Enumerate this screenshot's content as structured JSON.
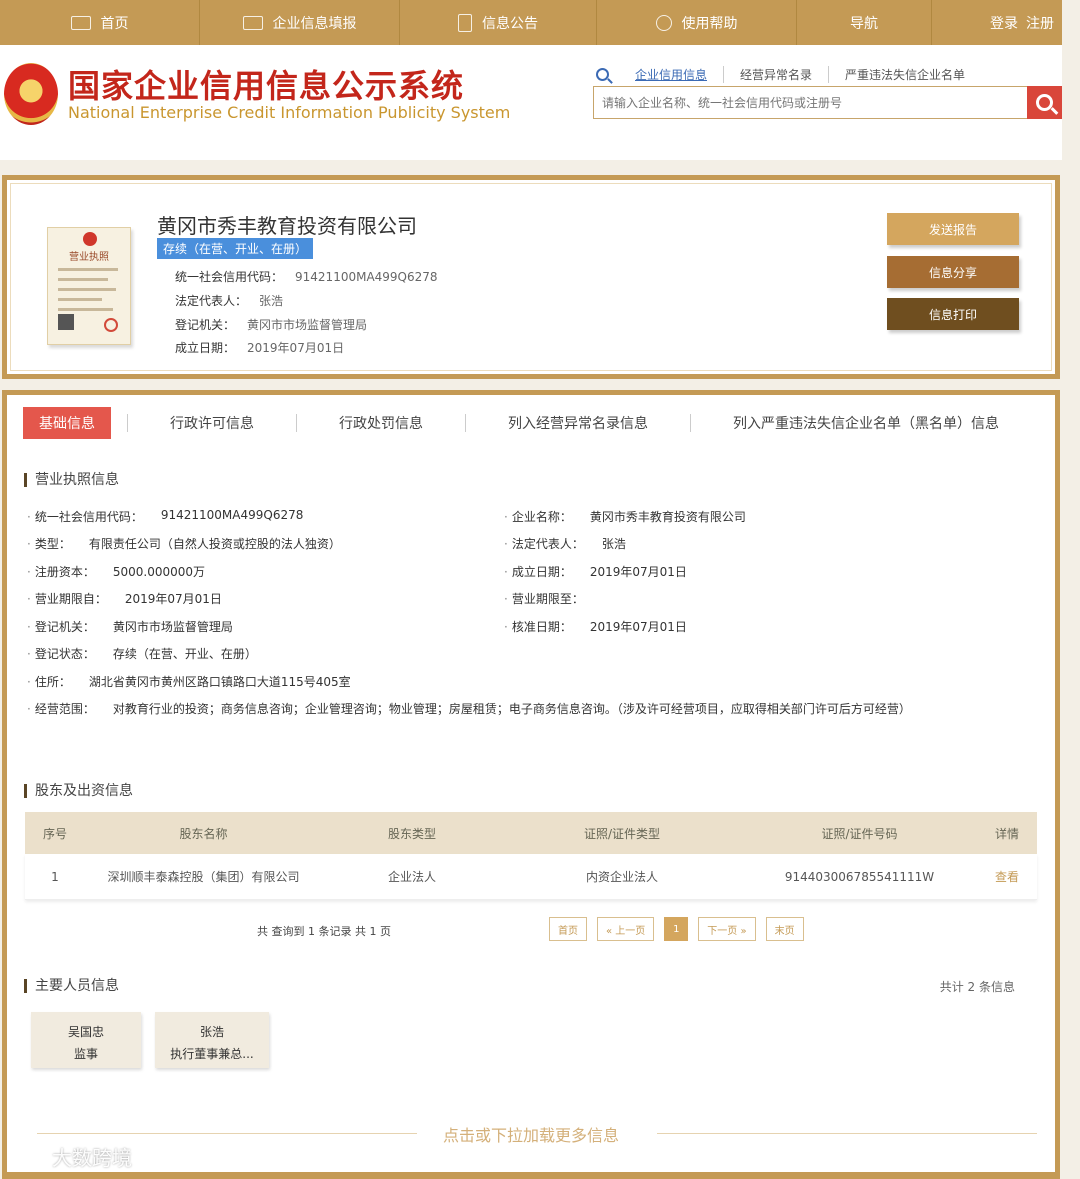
{
  "nav": {
    "home": "首页",
    "fill": "企业信息填报",
    "notice": "信息公告",
    "help": "使用帮助",
    "guide": "导航",
    "login": "登录",
    "register": "注册"
  },
  "header": {
    "title": "国家企业信用信息公示系统",
    "subtitle": "National Enterprise Credit Information Publicity System",
    "search_tabs": [
      "企业信用信息",
      "经营异常名录",
      "严重违法失信企业名单"
    ],
    "search_placeholder": "请输入企业名称、统一社会信用代码或注册号"
  },
  "company": {
    "name": "黄冈市秀丰教育投资有限公司",
    "status": "存续（在营、开业、在册）",
    "license_label": "营业执照",
    "credit_code_label": "统一社会信用代码：",
    "credit_code": "91421100MA499Q6278",
    "legal_rep_label": "法定代表人：",
    "legal_rep": "张浩",
    "authority_label": "登记机关：",
    "authority": "黄冈市市场监督管理局",
    "founded_label": "成立日期：",
    "founded": "2019年07月01日",
    "buttons": {
      "report": "发送报告",
      "share": "信息分享",
      "print": "信息打印"
    }
  },
  "tabs": [
    "基础信息",
    "行政许可信息",
    "行政处罚信息",
    "列入经营异常名录信息",
    "列入严重违法失信企业名单（黑名单）信息"
  ],
  "license_section": {
    "title": "营业执照信息",
    "credit_code_label": "统一社会信用代码：",
    "credit_code": "91421100MA499Q6278",
    "name_label": "企业名称：",
    "name": "黄冈市秀丰教育投资有限公司",
    "type_label": "类型：",
    "type": "有限责任公司（自然人投资或控股的法人独资）",
    "legal_rep_label": "法定代表人：",
    "legal_rep": "张浩",
    "capital_label": "注册资本：",
    "capital": "5000.000000万",
    "founded_label": "成立日期：",
    "founded": "2019年07月01日",
    "term_from_label": "营业期限自：",
    "term_from": "2019年07月01日",
    "term_to_label": "营业期限至：",
    "term_to": "",
    "authority_label": "登记机关：",
    "authority": "黄冈市市场监督管理局",
    "approved_label": "核准日期：",
    "approved": "2019年07月01日",
    "status_label": "登记状态：",
    "status": "存续（在营、开业、在册）",
    "address_label": "住所：",
    "address": "湖北省黄冈市黄州区路口镇路口大道115号405室",
    "scope_label": "经营范围：",
    "scope": "对教育行业的投资；商务信息咨询；企业管理咨询；物业管理；房屋租赁；电子商务信息咨询。（涉及许可经营项目，应取得相关部门许可后方可经营）"
  },
  "shareholders": {
    "title": "股东及出资信息",
    "headers": [
      "序号",
      "股东名称",
      "股东类型",
      "证照/证件类型",
      "证照/证件号码",
      "详情"
    ],
    "rows": [
      {
        "no": "1",
        "name": "深圳顺丰泰森控股（集团）有限公司",
        "type": "企业法人",
        "id_type": "内资企业法人",
        "id_no": "914403006785541111W",
        "detail": "查看"
      }
    ],
    "summary": "共 查询到 1 条记录 共 1 页",
    "pager": {
      "first": "首页",
      "prev": "« 上一页",
      "current": "1",
      "next": "下一页 »",
      "last": "末页"
    }
  },
  "persons": {
    "title": "主要人员信息",
    "count": "共计 2 条信息",
    "list": [
      {
        "name": "吴国忠",
        "role": "监事"
      },
      {
        "name": "张浩",
        "role": "执行董事兼总..."
      }
    ]
  },
  "load_more": "点击或下拉加载更多信息",
  "watermark": "大数跨境"
}
